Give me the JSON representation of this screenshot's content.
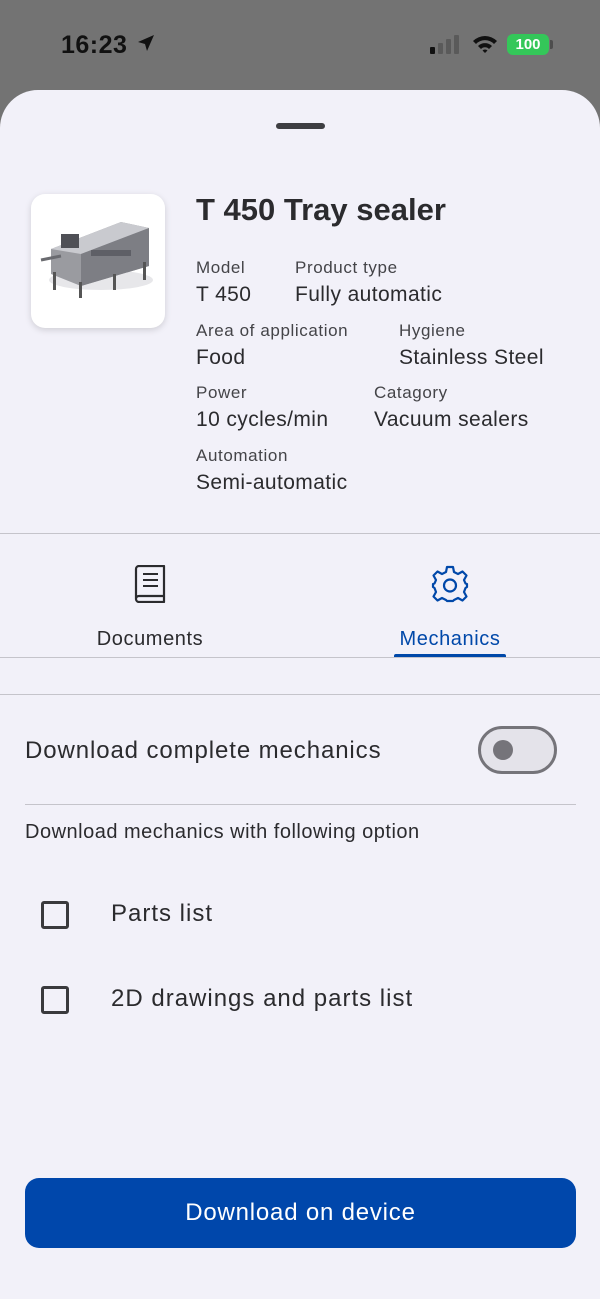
{
  "status_bar": {
    "time": "16:23",
    "battery": "100",
    "icons": [
      "location-arrow-icon",
      "cellular-signal-icon",
      "wifi-icon",
      "battery-icon"
    ]
  },
  "product": {
    "title": "T 450 Tray sealer",
    "image": "tray-sealer-machine-photo",
    "specs": {
      "model_label": "Model",
      "model_value": "T 450",
      "product_type_label": "Product type",
      "product_type_value": "Fully automatic",
      "area_label": "Area of application",
      "area_value": "Food",
      "hygiene_label": "Hygiene",
      "hygiene_value": "Stainless Steel",
      "power_label": "Power",
      "power_value": "10 cycles/min",
      "category_label": "Catagory",
      "category_value": "Vacuum sealers",
      "automation_label": "Automation",
      "automation_value": "Semi-automatic"
    }
  },
  "tabs": [
    {
      "label": "Documents",
      "icon": "book-icon",
      "active": false
    },
    {
      "label": "Mechanics",
      "icon": "gear-icon",
      "active": true
    }
  ],
  "mechanics": {
    "complete_label": "Download complete mechanics",
    "complete_toggle_on": false,
    "options_heading": "Download mechanics with following option",
    "options": [
      {
        "label": "Parts list",
        "checked": false
      },
      {
        "label": "2D drawings and parts list",
        "checked": false
      }
    ],
    "download_button": "Download on device"
  },
  "colors": {
    "accent": "#0047ab",
    "sheet_background": "#f2f1f9",
    "battery_green": "#34c759",
    "text": "#2b2b2e"
  }
}
